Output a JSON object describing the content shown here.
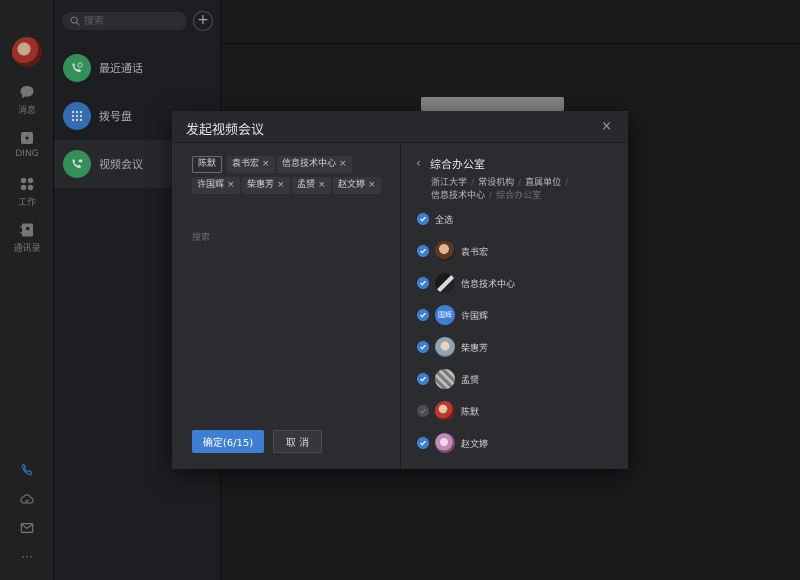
{
  "window": {
    "dot_colors": [
      "#fc605c",
      "#fdbc40",
      "#34c84a"
    ]
  },
  "rail": {
    "items": [
      {
        "label": "消息",
        "icon": "chat-bubble-icon"
      },
      {
        "label": "DING",
        "icon": "ding-icon"
      },
      {
        "label": "工作",
        "icon": "apps-grid-icon"
      },
      {
        "label": "通讯录",
        "icon": "contacts-book-icon"
      }
    ],
    "bottom_icons": [
      "phone-icon",
      "cloud-icon",
      "mail-icon",
      "more-icon"
    ]
  },
  "list": {
    "search_placeholder": "搜索",
    "items": [
      {
        "label": "最近通话",
        "icon": "recent-call-icon",
        "color": "#3daa68"
      },
      {
        "label": "拨号盘",
        "icon": "dialpad-icon",
        "color": "#3e7fd4"
      },
      {
        "label": "视频会议",
        "icon": "video-call-icon",
        "color": "#3daa68"
      }
    ]
  },
  "modal": {
    "title": "发起视频会议",
    "close": "×",
    "tags": [
      "陈默",
      "袁书宏",
      "信息技术中心",
      "许国辉",
      "柴惠芳",
      "孟赟",
      "赵文婷"
    ],
    "search_placeholder": "搜索",
    "confirm": "确定(6/15)",
    "cancel": "取 消",
    "right": {
      "back": "‹",
      "title": "综合办公室",
      "breadcrumb": [
        "浙江大学",
        "常设机构",
        "直属单位",
        "信息技术中心",
        "综合办公室"
      ],
      "select_all": "全选",
      "members": [
        {
          "name": "袁书宏",
          "checked": true
        },
        {
          "name": "信息技术中心",
          "checked": true
        },
        {
          "name": "许国辉",
          "checked": true,
          "avatar_text": "国辉"
        },
        {
          "name": "柴惠芳",
          "checked": true
        },
        {
          "name": "孟赟",
          "checked": true
        },
        {
          "name": "陈默",
          "checked": false
        },
        {
          "name": "赵文婷",
          "checked": true
        }
      ]
    }
  },
  "colors": {
    "accent": "#3e7fd4",
    "green": "#3daa68"
  }
}
